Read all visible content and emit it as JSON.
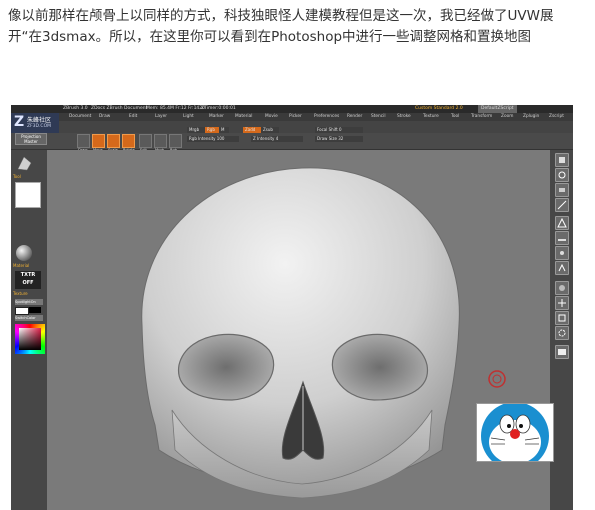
{
  "intro_text": [
    "像以前那样在颅骨上以同样的方式，科技独眼怪人建模教程但是这一次，我已经做了UVW展",
    "开“在3dsmax。所以，在这里你可以看到在Photoshop中进行一些调整网格和置换地图"
  ],
  "screenshot": {
    "titlebar": {
      "app": "ZBrush 3.0",
      "doc": "ZDocs ZBrush Document",
      "mem": "Mem: 85.4M  Fr:12  Fr:1420",
      "ztimer": "ZTimer:0:00:01",
      "right_menu": "Custom  Standard  2.0",
      "default_label": "DefaultZScript"
    },
    "logo": {
      "glyph": "Z",
      "line1": "朱峰社区",
      "line2": "ZF3D.COM"
    },
    "menus": [
      "Document",
      "Draw",
      "Edit",
      "Layer",
      "Light",
      "Marker",
      "Material",
      "Movie",
      "Picker",
      "Preferences",
      "Render",
      "Stencil",
      "Stroke",
      "Texture",
      "Tool",
      "Transform",
      "Zoom",
      "Zplugin",
      "Zscript"
    ],
    "projection_master": [
      "Projection",
      "Master"
    ],
    "tool_buttons": [
      "Draw",
      "Move",
      "Scale",
      "Rotate",
      "Edit",
      "Mrgb",
      "Rgb",
      "M",
      "Zadd"
    ],
    "fields": {
      "rgb_label": "Rgb",
      "mrgb_label": "Mrgb",
      "m_label": "M",
      "zadd": "Zadd",
      "zsub": "Zsub",
      "focal_shift": "Focal Shift 0",
      "rgb_intensity": "Rgb Intensity 100",
      "z_intensity": "Z Intensity 4",
      "draw_size": "Draw Size 32"
    },
    "left_panel": {
      "tool_label": "Tool",
      "material_label": "Material",
      "texture_label": "Texture",
      "texture_off": [
        "TXTR",
        "OFF"
      ],
      "spotlight_label": "SpotlightOn",
      "switch_color": "SwitchColor"
    }
  },
  "colors": {
    "accent_orange": "#d5691b",
    "canvas_gray": "#7a7a7a",
    "panel_gray": "#474747",
    "brush_ring": "#c03030"
  }
}
